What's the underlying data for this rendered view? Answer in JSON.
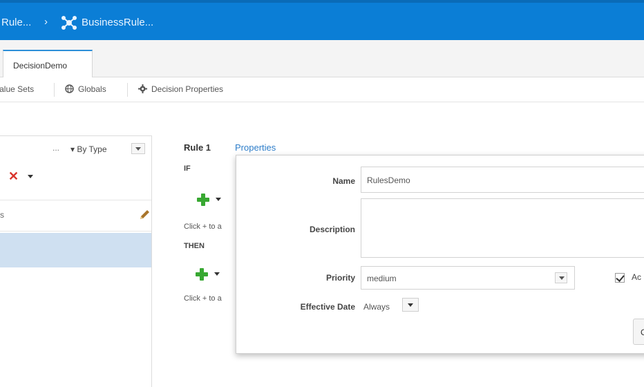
{
  "breadcrumb": {
    "item_1": "Rule...",
    "separator": "›",
    "item_2": "BusinessRule..."
  },
  "tabs": [
    {
      "label": "DecisionDemo"
    }
  ],
  "toolbar": {
    "value_sets": "Value Sets",
    "globals": "Globals",
    "decision_properties": "Decision Properties"
  },
  "left_panel": {
    "dots": "...",
    "by_type": "By Type",
    "row_text": "s"
  },
  "rule": {
    "title": "Rule 1",
    "properties_link": "Properties",
    "if_label": "IF",
    "then_label": "THEN",
    "click_hint": "Click + to a"
  },
  "properties": {
    "name_label": "Name",
    "name_value": "RulesDemo",
    "description_label": "Description",
    "description_value": "",
    "priority_label": "Priority",
    "priority_value": "medium",
    "active_label": "Ac",
    "effective_date_label": "Effective Date",
    "effective_date_value": "Always",
    "button_label": "C"
  },
  "colors": {
    "topbar": "#0b7ed6",
    "selected_row": "#cfe0f1",
    "link": "#2d7dc9",
    "add_icon": "#38a832",
    "delete_icon": "#d9332b"
  }
}
